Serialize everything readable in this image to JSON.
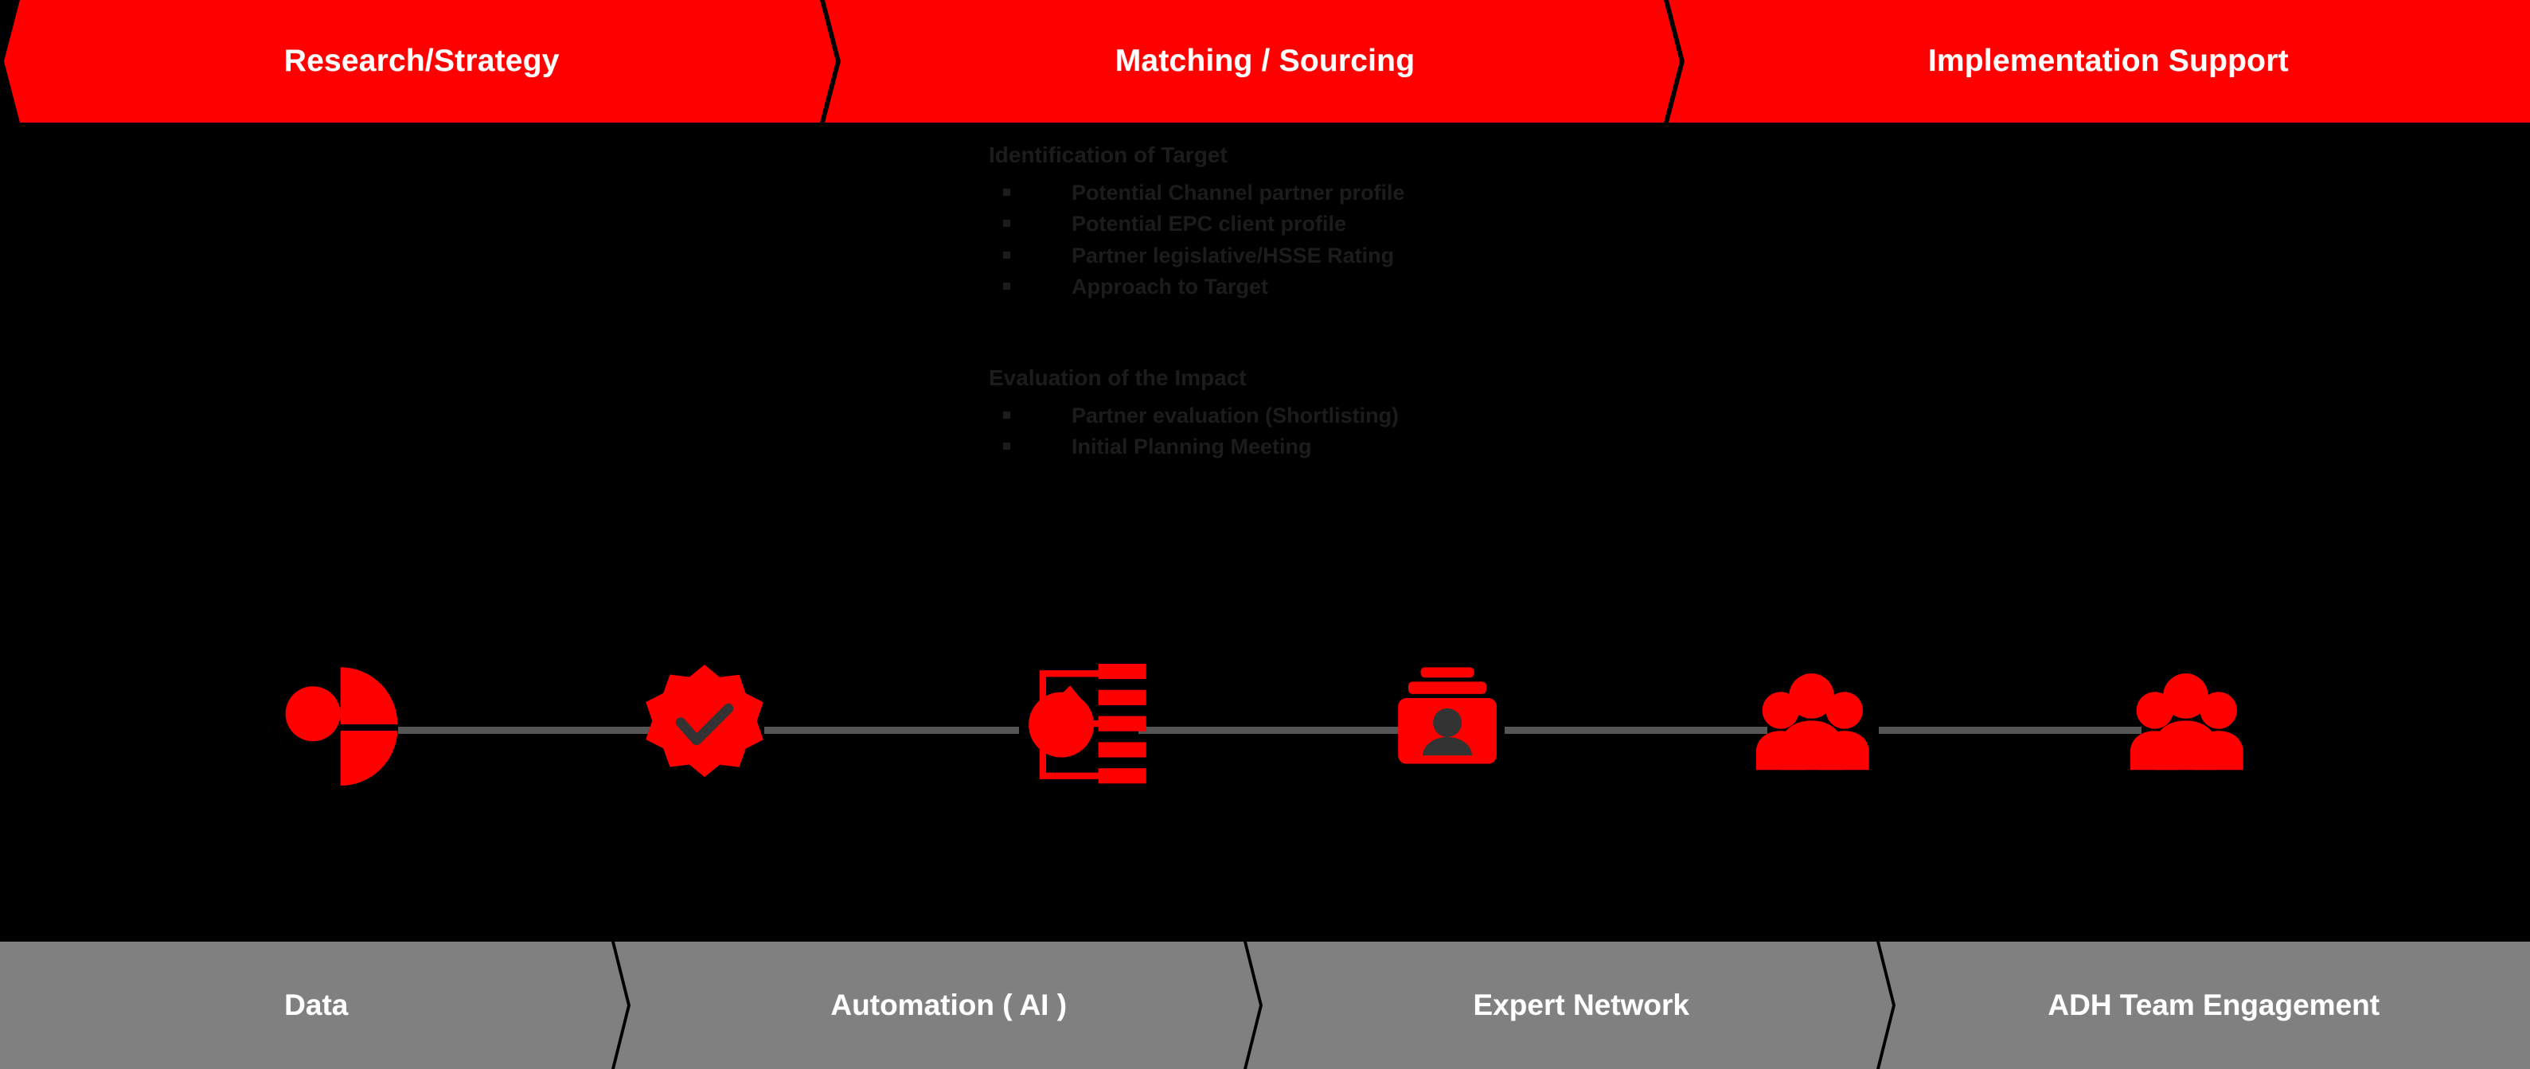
{
  "phases": {
    "items": [
      {
        "label": "Research/Strategy"
      },
      {
        "label": "Matching / Sourcing"
      },
      {
        "label": "Implementation Support"
      }
    ],
    "background_color": "#FF0000",
    "text_color": "#FFFFFF"
  },
  "detail": {
    "blocks": [
      {
        "heading": "Identification of Target",
        "bullets": [
          "Potential Channel partner profile",
          "Potential EPC client profile",
          "Partner legislative/HSSE Rating",
          "Approach to Target"
        ]
      },
      {
        "heading": "Evaluation of the Impact",
        "bullets": [
          "Partner evaluation (Shortlisting)",
          "Initial Planning Meeting"
        ]
      }
    ],
    "text_color": "#1c1c1c"
  },
  "timeline": {
    "connector_color": "#555555",
    "icon_color": "#FF0000",
    "nodes": [
      {
        "icon": "pie-chart-analysis-icon"
      },
      {
        "icon": "verified-check-badge-icon"
      },
      {
        "icon": "matching-filter-list-icon"
      },
      {
        "icon": "candidate-profile-card-icon"
      },
      {
        "icon": "team-group-icon"
      },
      {
        "icon": "team-group-icon"
      }
    ]
  },
  "enablers": {
    "items": [
      {
        "label": "Data"
      },
      {
        "label": "Automation ( AI )"
      },
      {
        "label": "Expert Network"
      },
      {
        "label": "ADH Team Engagement"
      }
    ],
    "background_color": "#808080",
    "text_color": "#FFFFFF"
  }
}
